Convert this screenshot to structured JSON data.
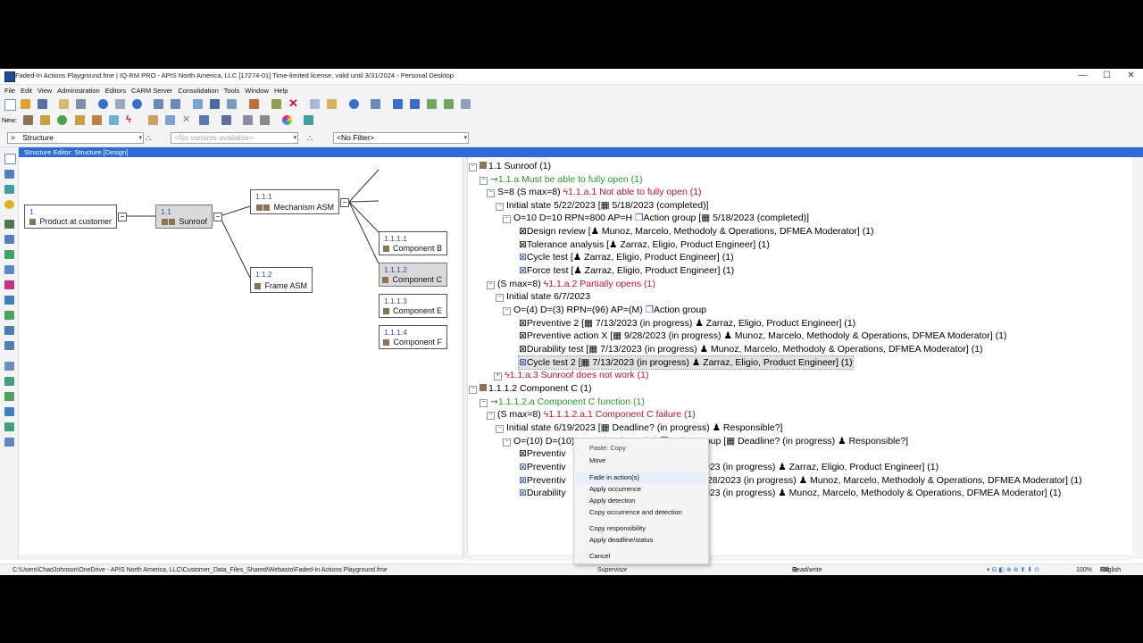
{
  "window": {
    "title": "Faded-In Actions Playground.fme | IQ-RM PRO - APIS North America, LLC [17274-01] Time-limited license, valid until 3/31/2024 - Personal Desktop",
    "minimize": "—",
    "maximize": "☐",
    "close": "✕"
  },
  "menu": [
    "File",
    "Edit",
    "View",
    "Administration",
    "Editors",
    "CARM Server",
    "Consolidation",
    "Tools",
    "Window",
    "Help"
  ],
  "toolbar": {
    "new_label": "New:"
  },
  "filterbar": {
    "structure_value": "Structure",
    "structure_prefix": ">",
    "variants_placeholder": "<No variants available>",
    "filter_value": "<No Filter>"
  },
  "editor": {
    "header": "Structure Editor: Structure [Design]"
  },
  "diagram": {
    "nodes": [
      {
        "id": "1",
        "name": "Product at customer"
      },
      {
        "id": "1.1",
        "name": "Sunroof"
      },
      {
        "id": "1.1.1",
        "name": "Mechanism ASM"
      },
      {
        "id": "1.1.2",
        "name": "Frame ASM"
      },
      {
        "id": "1.1.1.1",
        "name": "Component B"
      },
      {
        "id": "1.1.1.2",
        "name": "Component C"
      },
      {
        "id": "1.1.1.3",
        "name": "Component E"
      },
      {
        "id": "1.1.1.4",
        "name": "Component F"
      }
    ]
  },
  "tree": [
    {
      "t1": "1.1 Sunroof (1)"
    },
    {
      "t1": "1.1.a",
      "t2": " Must be able to fully open (1)"
    },
    {
      "t1": "S=8 (S max=8) ",
      "t2": "1.1.a.1",
      "t3": " Not able to fully open (1)"
    },
    {
      "t1": "Initial state 5/22/2023 [",
      "t2": " 5/18/2023 (completed)]"
    },
    {
      "t1": "O=10 D=10 RPN=800 AP=H ",
      "t2": "Action group [",
      "t3": " 5/18/2023 (completed)]"
    },
    {
      "t1": "Design review [",
      "t2": " Munoz, Marcelo, Methodoly & Operations, DFMEA Moderator] (1)"
    },
    {
      "t1": "Tolerance analysis [",
      "t2": " Zarraz, Eligio, Product Engineer] (1)"
    },
    {
      "t1": "Cycle test [",
      "t2": " Zarraz, Eligio, Product Engineer] (1)"
    },
    {
      "t1": "Force test [",
      "t2": " Zarraz, Eligio, Product Engineer] (1)"
    },
    {
      "t1": "(S max=8) ",
      "t2": "1.1.a.2",
      "t3": " Partially opens (1)"
    },
    {
      "t1": "Initial state 6/7/2023"
    },
    {
      "t1": "O=(4) D=(3) RPN=(96) AP=(M) ",
      "t2": "Action group"
    },
    {
      "t1": "Preventive 2 [",
      "t2": " 7/13/2023 (in progress) ",
      "t3": " Zarraz, Eligio, Product Engineer] (1)"
    },
    {
      "t1": "Preventive action X [",
      "t2": " 9/28/2023 (in progress) ",
      "t3": " Munoz, Marcelo, Methodoly & Operations, DFMEA Moderator] (1)"
    },
    {
      "t1": "Durability test [",
      "t2": " 7/13/2023 (in progress) ",
      "t3": " Munoz, Marcelo, Methodoly & Operations, DFMEA Moderator] (1)"
    },
    {
      "t1": "Cycle test 2 [",
      "t2": " 7/13/2023 (in progress) ",
      "t3": " Zarraz, Eligio, Product Engineer] (1)"
    },
    {
      "t1": "1.1.a.3",
      "t2": " Sunroof does not work (1)"
    },
    {
      "t1": "1.1.1.2 Component C (1)"
    },
    {
      "t1": "1.1.1.2.a",
      "t2": " Component C function (1)"
    },
    {
      "t1": "(S max=8) ",
      "t2": "1.1.1.2.a.1",
      "t3": " Component C failure (1)"
    },
    {
      "t1": "Initial state 6/19/2023 [",
      "t2": " Deadline? (in progress) ",
      "t3": " Responsible?]"
    },
    {
      "t1": "O=(10) D=(10) RPN=(100) AP=(H) ",
      "t2": "Action group [",
      "t3": " Deadline? (in progress) ",
      "t4": " Responsible?]"
    },
    {
      "t1": "Preventiv"
    },
    {
      "t1": "Preventiv",
      "t2": "023 (in progress) ",
      "t3": " Zarraz, Eligio, Product Engineer] (1)"
    },
    {
      "t1": "Preventiv",
      "t2": "/28/2023 (in progress) ",
      "t3": " Munoz, Marcelo, Methodoly & Operations, DFMEA Moderator] (1)"
    },
    {
      "t1": "Durability",
      "t2": "023 (in progress) ",
      "t3": " Munoz, Marcelo, Methodoly & Operations, DFMEA Moderator] (1)"
    }
  ],
  "context_menu": {
    "items": [
      "Paste: Copy",
      "Move",
      "Fade in action(s)",
      "Apply occurrence",
      "Apply detection",
      "Copy occurrence and detection",
      "Copy responsibility",
      "Apply deadline/status",
      "Cancel"
    ]
  },
  "statusbar": {
    "path": "C:\\Users\\ChadJohnson\\OneDrive - APIS North America, LLC\\Customer_Data_Files_Shared\\Webasto\\Faded-In Actions Playground.fme",
    "role": "Supervisor",
    "access": "Read/write",
    "zoom": "100%",
    "language": "English"
  }
}
